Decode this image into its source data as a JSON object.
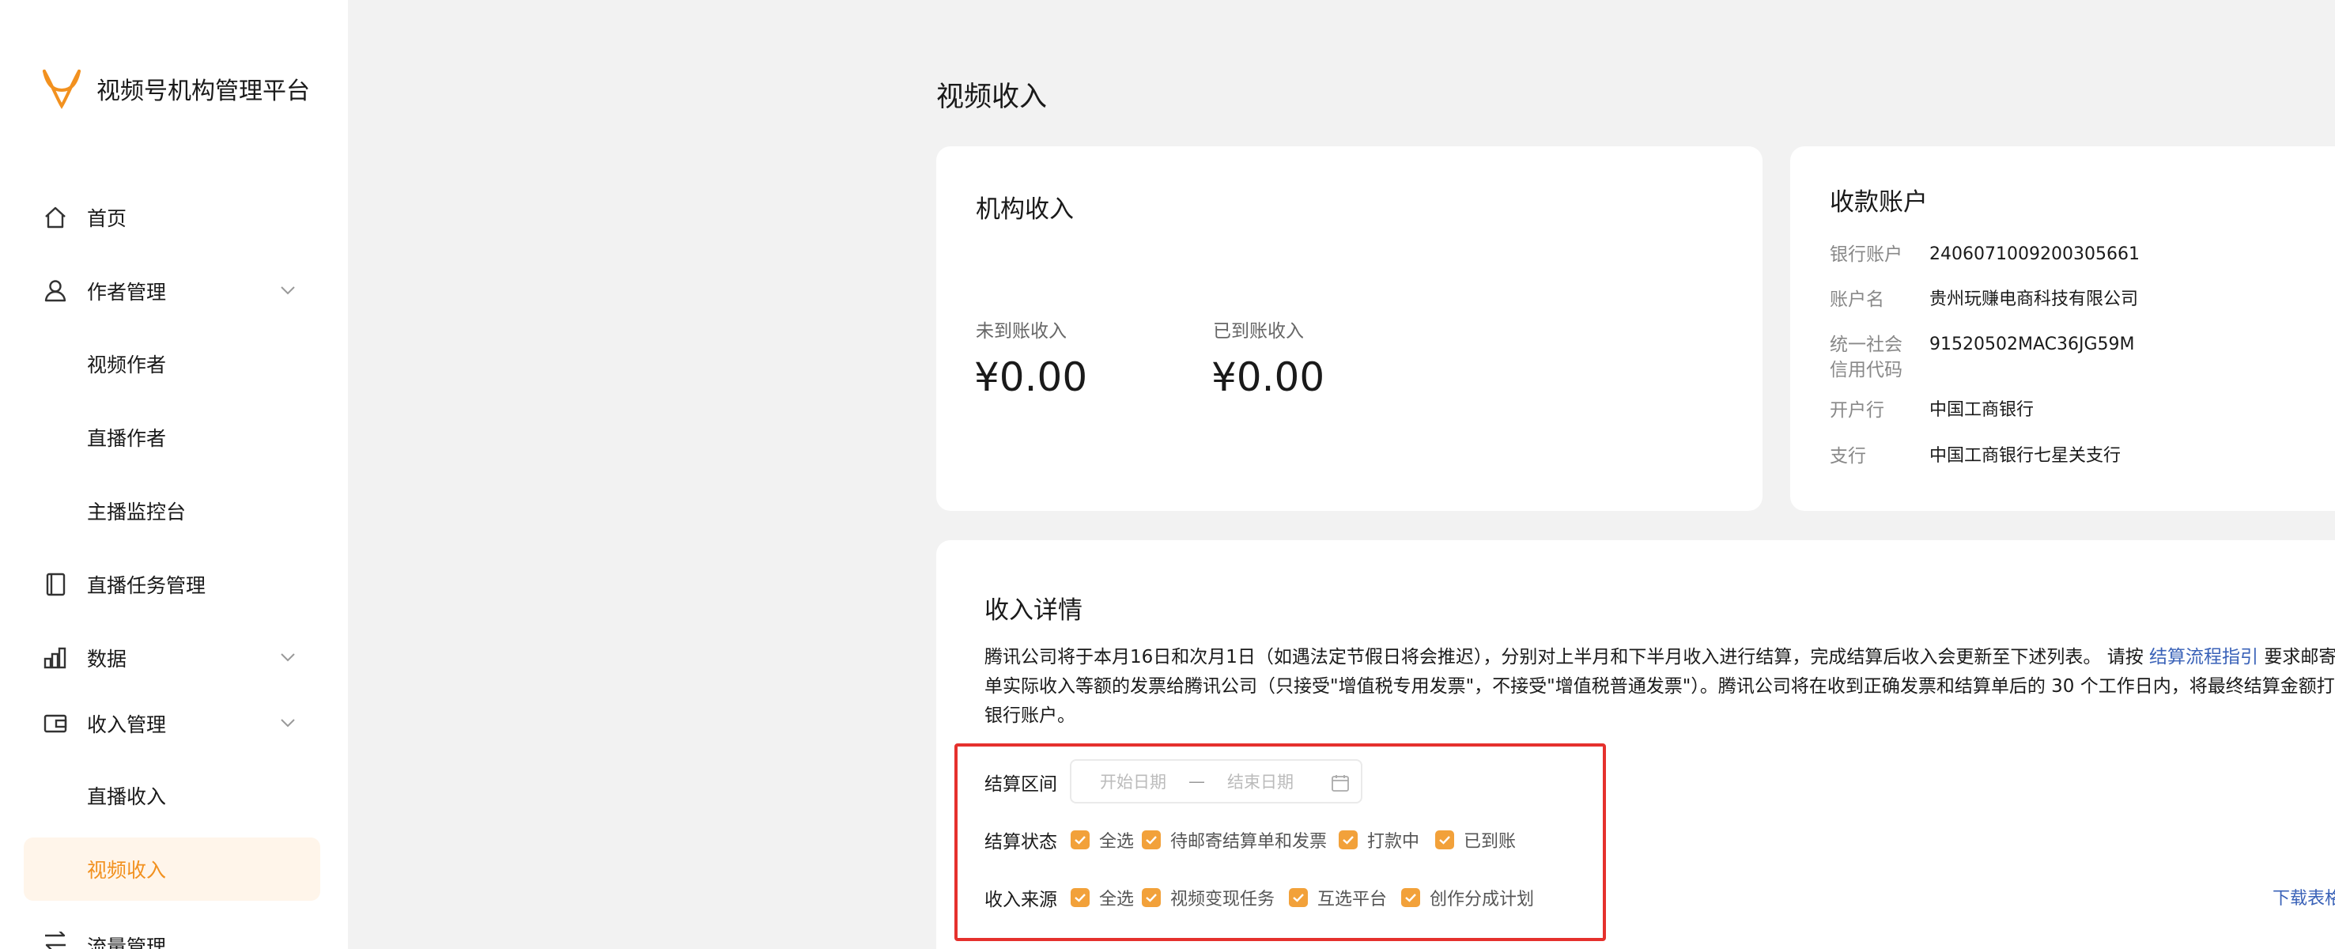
{
  "app": {
    "title": "视频号机构管理平台"
  },
  "colors": {
    "accent": "#f2911f",
    "link": "#3a62b8",
    "highlight_border": "#e5312d"
  },
  "sidebar": {
    "items": [
      {
        "label": "首页",
        "icon": "home-icon"
      },
      {
        "label": "作者管理",
        "icon": "user-icon",
        "expandable": true
      },
      {
        "label": "视频作者",
        "sub": true
      },
      {
        "label": "直播作者",
        "sub": true
      },
      {
        "label": "主播监控台",
        "sub": true
      },
      {
        "label": "直播任务管理",
        "icon": "book-icon"
      },
      {
        "label": "数据",
        "icon": "bar-chart-icon",
        "expandable": true
      },
      {
        "label": "收入管理",
        "icon": "wallet-icon",
        "expandable": true
      },
      {
        "label": "直播收入",
        "sub": true
      },
      {
        "label": "视频收入",
        "sub": true,
        "active": true
      },
      {
        "label": "流量管理",
        "icon": "swap-icon"
      }
    ]
  },
  "page": {
    "title": "视频收入"
  },
  "org_income": {
    "title": "机构收入",
    "pending_label": "未到账收入",
    "pending_value": "¥0.00",
    "received_label": "已到账收入",
    "received_value": "¥0.00"
  },
  "account": {
    "title": "收款账户",
    "bank_account_label": "银行账户",
    "bank_account_value": "2406071009200305661",
    "account_name_label": "账户名",
    "account_name_value": "贵州玩赚电商科技有限公司",
    "credit_code_label": "统一社会信用代码",
    "credit_code_value": "91520502MAC36JG59M",
    "bank_label": "开户行",
    "bank_value": "中国工商银行",
    "branch_label": "支行",
    "branch_value": "中国工商银行七星关支行"
  },
  "details": {
    "title": "收入详情",
    "desc_part1": "腾讯公司将于本月16日和次月1日（如遇法定节假日将会推迟），分别对上半月和下半月收入进行结算，完成结算后收入会更新至下述列表。 请按 ",
    "desc_link": "结算流程指引",
    "desc_part2": " 要求邮寄与结算单实际收入等额的发票给腾讯公司（只接受\"增值税专用发票\"，不接受\"增值税普通发票\"）。腾讯公司将在收到正确发票和结算单后的 30 个工作日内，将最终结算金额打入结算银行账户。",
    "download_label": "下载表格"
  },
  "filters": {
    "period_label": "结算区间",
    "start_placeholder": "开始日期",
    "dash": "—",
    "end_placeholder": "结束日期",
    "status_label": "结算状态",
    "status_options": [
      "全选",
      "待邮寄结算单和发票",
      "打款中",
      "已到账"
    ],
    "source_label": "收入来源",
    "source_options": [
      "全选",
      "视频变现任务",
      "互选平台",
      "创作分成计划"
    ]
  }
}
